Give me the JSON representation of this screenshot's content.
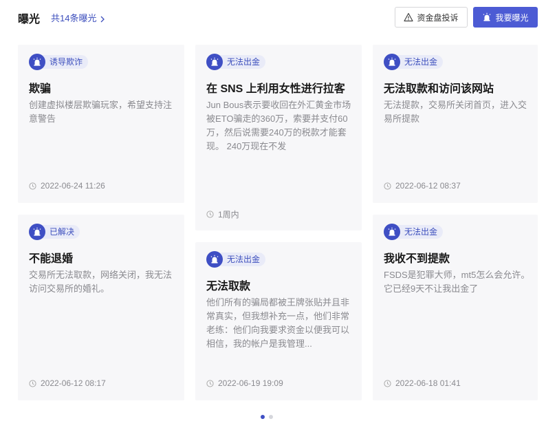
{
  "header": {
    "title": "曝光",
    "count_link": "共14条曝光",
    "complain_button": "资金盘投诉",
    "expose_button": "我要曝光"
  },
  "cards": [
    {
      "tag": "诱导欺诈",
      "title": "欺骗",
      "desc": "创建虚拟楼层欺骗玩家，希望支持注意警告",
      "time": "2022-06-24 11:26"
    },
    {
      "tag": "无法出金",
      "title": "在 SNS 上利用女性进行拉客",
      "desc": "Jun Bous表示要收回在外汇黄金市场被ETO骗走的360万，索要并支付60万，然后说需要240万的税款才能套现。 240万现在不发",
      "time": "1周内"
    },
    {
      "tag": "无法出金",
      "title": "无法取款和访问该网站",
      "desc": "无法提款，交易所关闭首页，进入交易所提款",
      "time": "2022-06-12 08:37"
    },
    {
      "tag": "已解决",
      "title": "不能退婚",
      "desc": "交易所无法取款，网络关闭，我无法访问交易所的婚礼。",
      "time": "2022-06-12 08:17"
    },
    {
      "tag": "无法出金",
      "title": "无法取款",
      "desc": "他们所有的骗局都被王牌张贴并且非常真实，但我想补充一点，他们非常老练：他们向我要求资金以便我可以相信，我的帐户是我管理...",
      "time": "2022-06-19 19:09"
    },
    {
      "tag": "无法出金",
      "title": "我收不到提款",
      "desc": "FSDS是犯罪大师，mt5怎么会允许。它已经9天不让我出金了",
      "time": "2022-06-18 01:41"
    }
  ],
  "pagination": {
    "total": 2,
    "active": 0
  },
  "colors": {
    "accent": "#4c5bd4",
    "badge_bg": "#e9ebf8",
    "card_bg": "#f7f7f9"
  }
}
